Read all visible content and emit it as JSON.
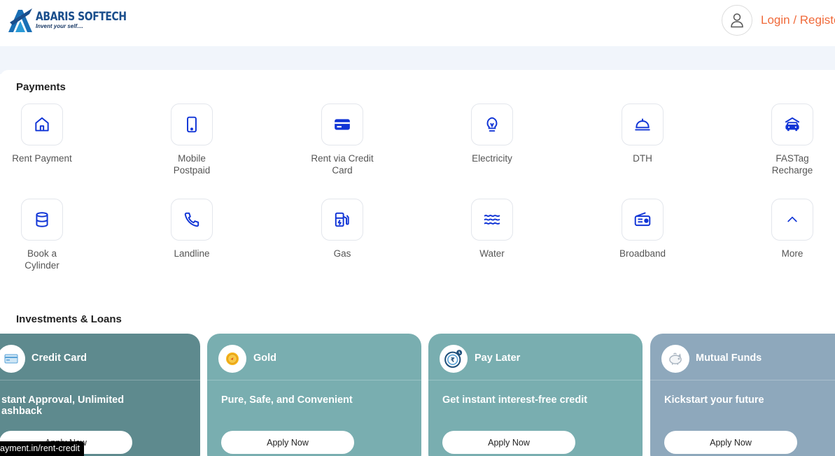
{
  "header": {
    "brand_name": "ABARIS SOFTECH",
    "brand_tagline": "Invent your self....",
    "login_label": "Login / Registe"
  },
  "colors": {
    "accent": "#f06a3a",
    "icon_blue": "#1034d6",
    "card_creditcard": "#5e8a8e",
    "card_gold": "#79aeb0",
    "card_paylater": "#79aeb0",
    "card_mutual": "#8ea8bc"
  },
  "payments": {
    "title": "Payments",
    "items": [
      {
        "label": "Rent Payment",
        "icon": "home-icon"
      },
      {
        "label": "Mobile Postpaid",
        "icon": "mobile-icon"
      },
      {
        "label": "Rent via Credit Card",
        "icon": "credit-card-icon"
      },
      {
        "label": "Electricity",
        "icon": "bulb-icon"
      },
      {
        "label": "DTH",
        "icon": "dish-icon"
      },
      {
        "label": "FASTag Recharge",
        "icon": "car-icon"
      },
      {
        "label": "Book a Cylinder",
        "icon": "cylinder-icon"
      },
      {
        "label": "Landline",
        "icon": "phone-icon"
      },
      {
        "label": "Gas",
        "icon": "gas-pump-icon"
      },
      {
        "label": "Water",
        "icon": "water-icon"
      },
      {
        "label": "Broadband",
        "icon": "router-icon"
      },
      {
        "label": "More",
        "icon": "chevron-up-icon"
      }
    ]
  },
  "investments": {
    "title": "Investments & Loans",
    "cards": [
      {
        "title": "Credit Card",
        "desc": "stant Approval, Unlimited ashback",
        "button": "Apply Now",
        "icon": "card-icon"
      },
      {
        "title": "Gold",
        "desc": "Pure, Safe, and Convenient",
        "button": "Apply Now",
        "icon": "gold-coin-icon"
      },
      {
        "title": "Pay Later",
        "desc": "Get instant interest-free credit",
        "button": "Apply Now",
        "icon": "rupee-clock-icon"
      },
      {
        "title": "Mutual Funds",
        "desc": "Kickstart your future",
        "button": "Apply Now",
        "icon": "piggy-bank-icon"
      }
    ]
  },
  "status_bar": {
    "url": "ayment.in/rent-credit"
  }
}
